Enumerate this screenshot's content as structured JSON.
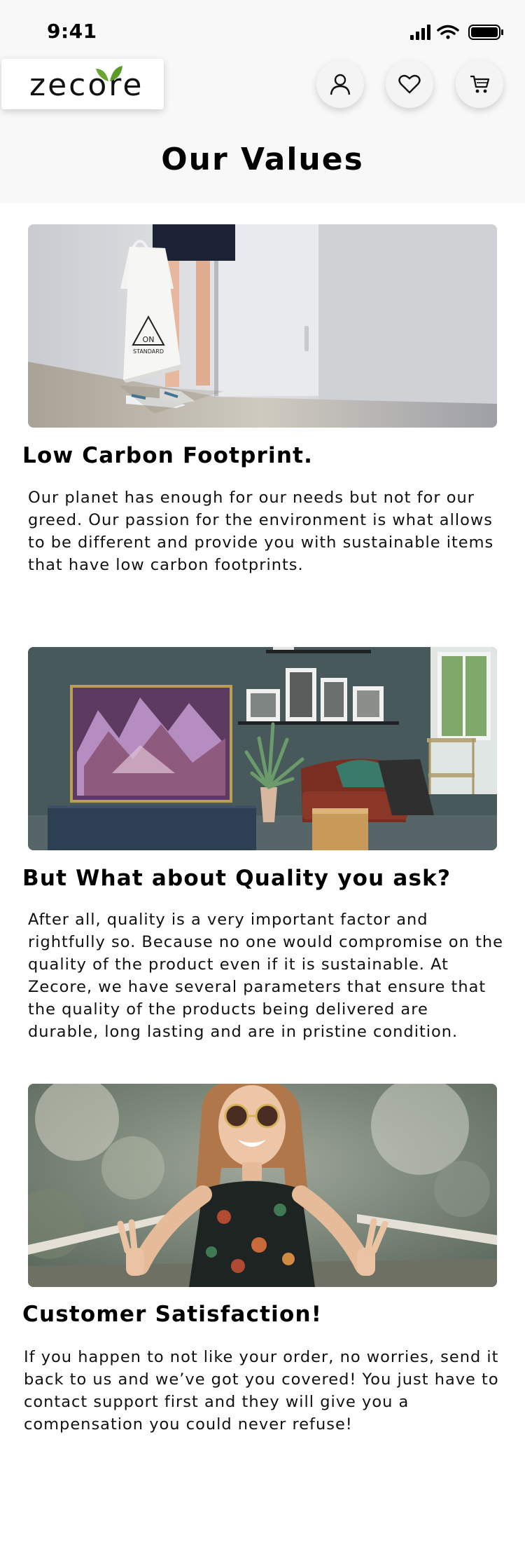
{
  "status": {
    "time": "9:41"
  },
  "header": {
    "logo_text": "zecore",
    "title": "Our Values",
    "buttons": {
      "account_icon": "user-icon",
      "wishlist_icon": "heart-icon",
      "cart_icon": "cart-icon"
    }
  },
  "sections": [
    {
      "heading": "Low Carbon Footprint.",
      "body": "Our planet has enough for our needs but not for our greed. Our passion for the environment is what allows to be different and provide you with sustainable items that have low carbon footprints.",
      "image": {
        "bag_text_1": "ON",
        "bag_text_2": "STANDARD"
      }
    },
    {
      "heading": "But What about Quality you ask?",
      "body": "After all, quality is a very important factor and rightfully so. Because no one would compromise on the quality of the product even if it is sustainable. At Zecore, we have several parameters that ensure that the quality of the products being delivered are durable, long lasting and are in pristine condition."
    },
    {
      "heading": "Customer Satisfaction!",
      "body": "If you happen to not like your order, no worries, send it back to us and we’ve got you covered! You just have to contact support first and they will give you a compensation you could never refuse!"
    }
  ],
  "colors": {
    "leaf_green": "#6aa532",
    "header_bg": "#f8f8f8"
  }
}
